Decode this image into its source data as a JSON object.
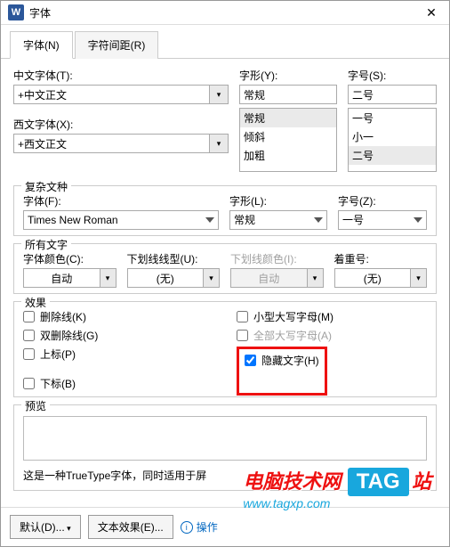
{
  "window": {
    "title": "字体",
    "close": "✕",
    "appicon": "W"
  },
  "tabs": {
    "font": "字体(N)",
    "spacing": "字符间距(R)"
  },
  "section1": {
    "cnfont_label": "中文字体(T):",
    "cnfont_value": "+中文正文",
    "style_label": "字形(Y):",
    "style_value": "常规",
    "style_items": [
      "常规",
      "倾斜",
      "加粗"
    ],
    "size_label": "字号(S):",
    "size_value": "二号",
    "size_items": [
      "一号",
      "小一",
      "二号"
    ],
    "wfont_label": "西文字体(X):",
    "wfont_value": "+西文正文"
  },
  "complex": {
    "legend": "复杂文种",
    "font_label": "字体(F):",
    "font_value": "Times New Roman",
    "style_label": "字形(L):",
    "style_value": "常规",
    "size_label": "字号(Z):",
    "size_value": "一号"
  },
  "alltext": {
    "legend": "所有文字",
    "color_label": "字体颜色(C):",
    "color_value": "自动",
    "uline_label": "下划线线型(U):",
    "uline_value": "(无)",
    "ulinecolor_label": "下划线颜色(I):",
    "ulinecolor_value": "自动",
    "emph_label": "着重号:",
    "emph_value": "(无)"
  },
  "effects": {
    "legend": "效果",
    "strike": "删除线(K)",
    "dstrike": "双删除线(G)",
    "super": "上标(P)",
    "sub": "下标(B)",
    "smallcaps": "小型大写字母(M)",
    "allcaps": "全部大写字母(A)",
    "hidden": "隐藏文字(H)"
  },
  "preview": {
    "legend": "预览",
    "desc_prefix": "这是一种TrueType字体，同时适用于屏"
  },
  "footer": {
    "default": "默认(D)...",
    "texteff": "文本效果(E)...",
    "hint": "操作"
  },
  "watermark": {
    "red": "电脑技术网",
    "tag": "TAG",
    "site": "www.tagxp.com",
    "sub": "站"
  }
}
